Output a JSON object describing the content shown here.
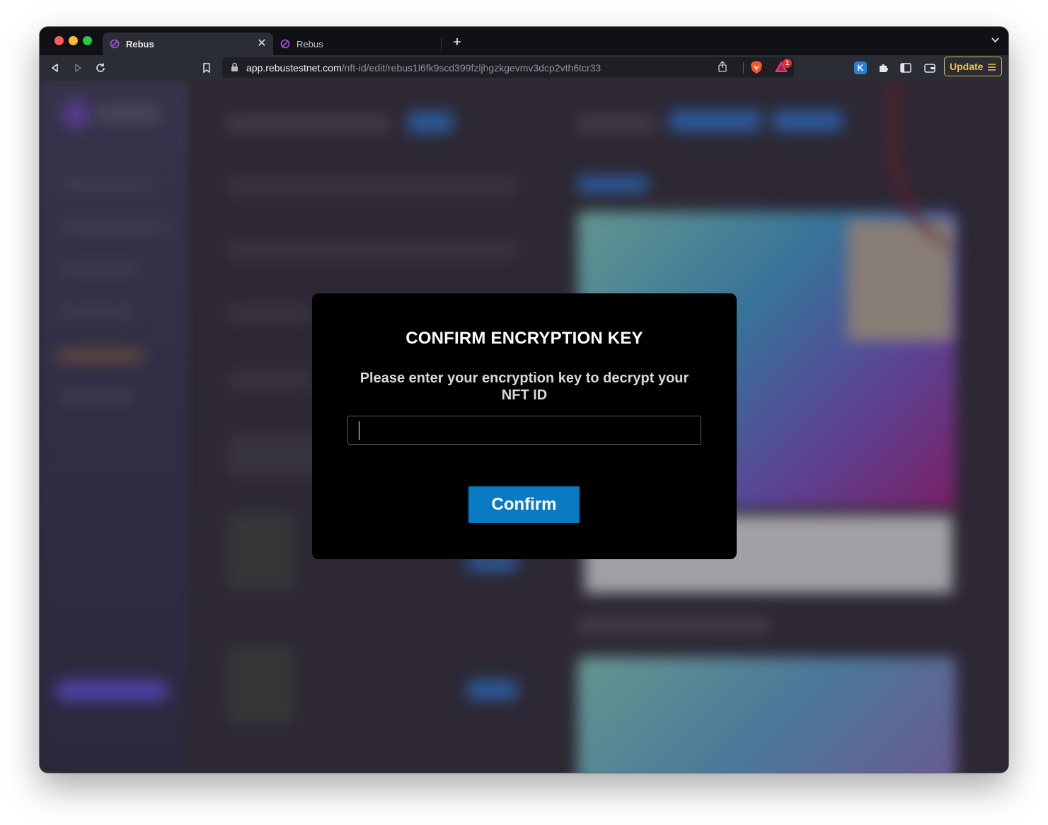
{
  "browser": {
    "tabs": [
      {
        "label": "Rebus",
        "active": true
      },
      {
        "label": "Rebus",
        "active": false
      }
    ],
    "url_host": "app.rebustestnet.com",
    "url_path": "/nft-id/edit/rebus1l6fk9scd399fzljhgzkgevmv3dcp2vth6tcr33",
    "rewards_badge": "1",
    "extension_letter": "K",
    "update_label": "Update"
  },
  "modal": {
    "title": "CONFIRM ENCRYPTION KEY",
    "subtitle": "Please enter your encryption key to decrypt your NFT ID",
    "input_value": "",
    "input_placeholder": "",
    "confirm_label": "Confirm"
  },
  "colors": {
    "accent": "#0a7ac4",
    "modal_bg": "#000000",
    "update_border": "#e5b94a"
  }
}
